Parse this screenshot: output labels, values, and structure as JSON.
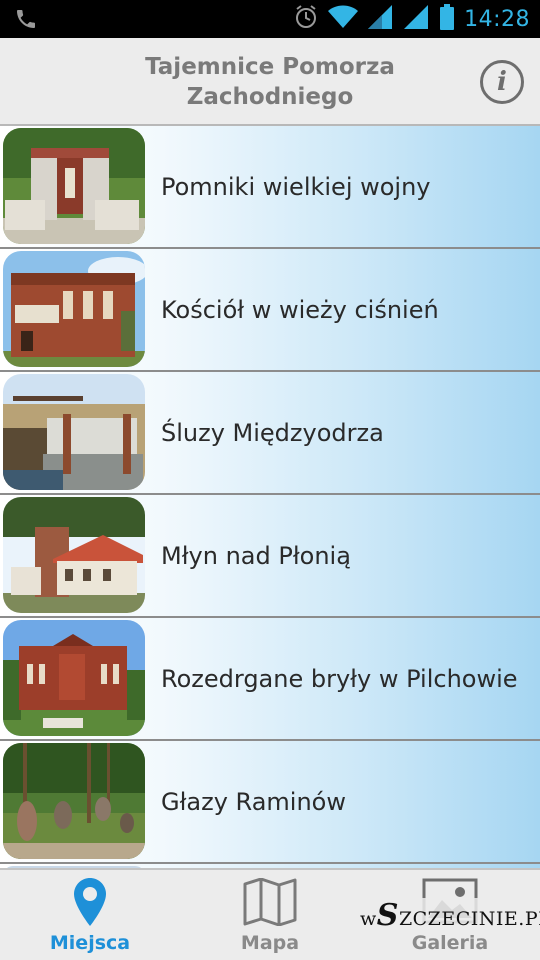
{
  "status_bar": {
    "time": "14:28",
    "icons": [
      "phone-icon",
      "alarm-icon",
      "wifi-icon",
      "signal-icon",
      "signal-icon",
      "battery-icon"
    ]
  },
  "header": {
    "title": "Tajemnice Pomorza Zachodniego",
    "info_icon": "info-icon",
    "info_glyph": "i"
  },
  "places": [
    {
      "label": "Pomniki wielkiej wojny",
      "thumb": "memorial-photo"
    },
    {
      "label": "Kościół w wieży ciśnień",
      "thumb": "church-photo"
    },
    {
      "label": "Śluzy Międzyodrza",
      "thumb": "locks-photo"
    },
    {
      "label": "Młyn nad Płonią",
      "thumb": "mill-photo"
    },
    {
      "label": "Rozedrgane bryły w Pilchowie",
      "thumb": "pilchowo-photo"
    },
    {
      "label": "Głazy Raminów",
      "thumb": "stones-photo"
    }
  ],
  "nav": {
    "tabs": [
      {
        "label": "Miejsca",
        "icon": "map-pin-icon",
        "active": true
      },
      {
        "label": "Mapa",
        "icon": "map-icon",
        "active": false
      },
      {
        "label": "Galeria",
        "icon": "image-icon",
        "active": false
      }
    ]
  },
  "watermark": {
    "prefix": "w",
    "initial": "S",
    "rest": "ZCZECINIE.PL"
  },
  "colors": {
    "accent": "#33b5e5",
    "active_tab": "#1e90d8",
    "list_gradient_end": "#a6d6f2"
  }
}
